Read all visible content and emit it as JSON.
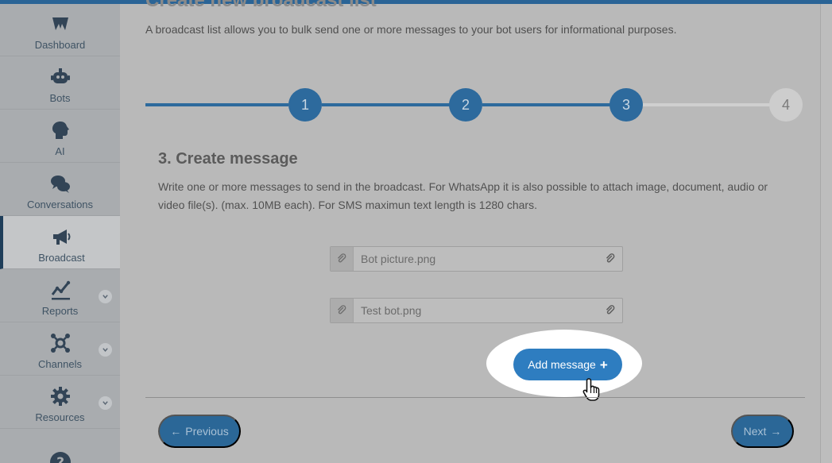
{
  "sidebar": {
    "items": [
      {
        "label": "Dashboard",
        "icon": "dashboard-logo-icon"
      },
      {
        "label": "Bots",
        "icon": "robot-icon"
      },
      {
        "label": "AI",
        "icon": "head-icon"
      },
      {
        "label": "Conversations",
        "icon": "chat-bubbles-icon"
      },
      {
        "label": "Broadcast",
        "icon": "megaphone-icon",
        "active": true
      },
      {
        "label": "Reports",
        "icon": "line-chart-icon",
        "expandable": true
      },
      {
        "label": "Channels",
        "icon": "network-icon",
        "expandable": true
      },
      {
        "label": "Resources",
        "icon": "gear-icon",
        "expandable": true
      },
      {
        "label": "",
        "icon": "help-icon"
      }
    ]
  },
  "page": {
    "title": "Create new broadcast list",
    "description": "A broadcast list allows you to bulk send one or more messages to your bot users for informational purposes."
  },
  "stepper": {
    "steps": [
      "1",
      "2",
      "3",
      "4"
    ],
    "current": 3
  },
  "section": {
    "title": "3. Create message",
    "description": "Write one or more messages to send in the broadcast. For WhatsApp it is also possible to attach image, document, audio or video file(s). (max. 10MB each). For SMS maximun text length is 1280 chars."
  },
  "attachments": [
    {
      "filename": "Bot picture.png"
    },
    {
      "filename": "Test bot.png"
    }
  ],
  "buttons": {
    "add_message": "Add message",
    "previous": "Previous",
    "next": "Next"
  },
  "colors": {
    "primary": "#2e7dc0",
    "step_done": "#2d6a9d",
    "step_todo": "#cdcdcd"
  }
}
